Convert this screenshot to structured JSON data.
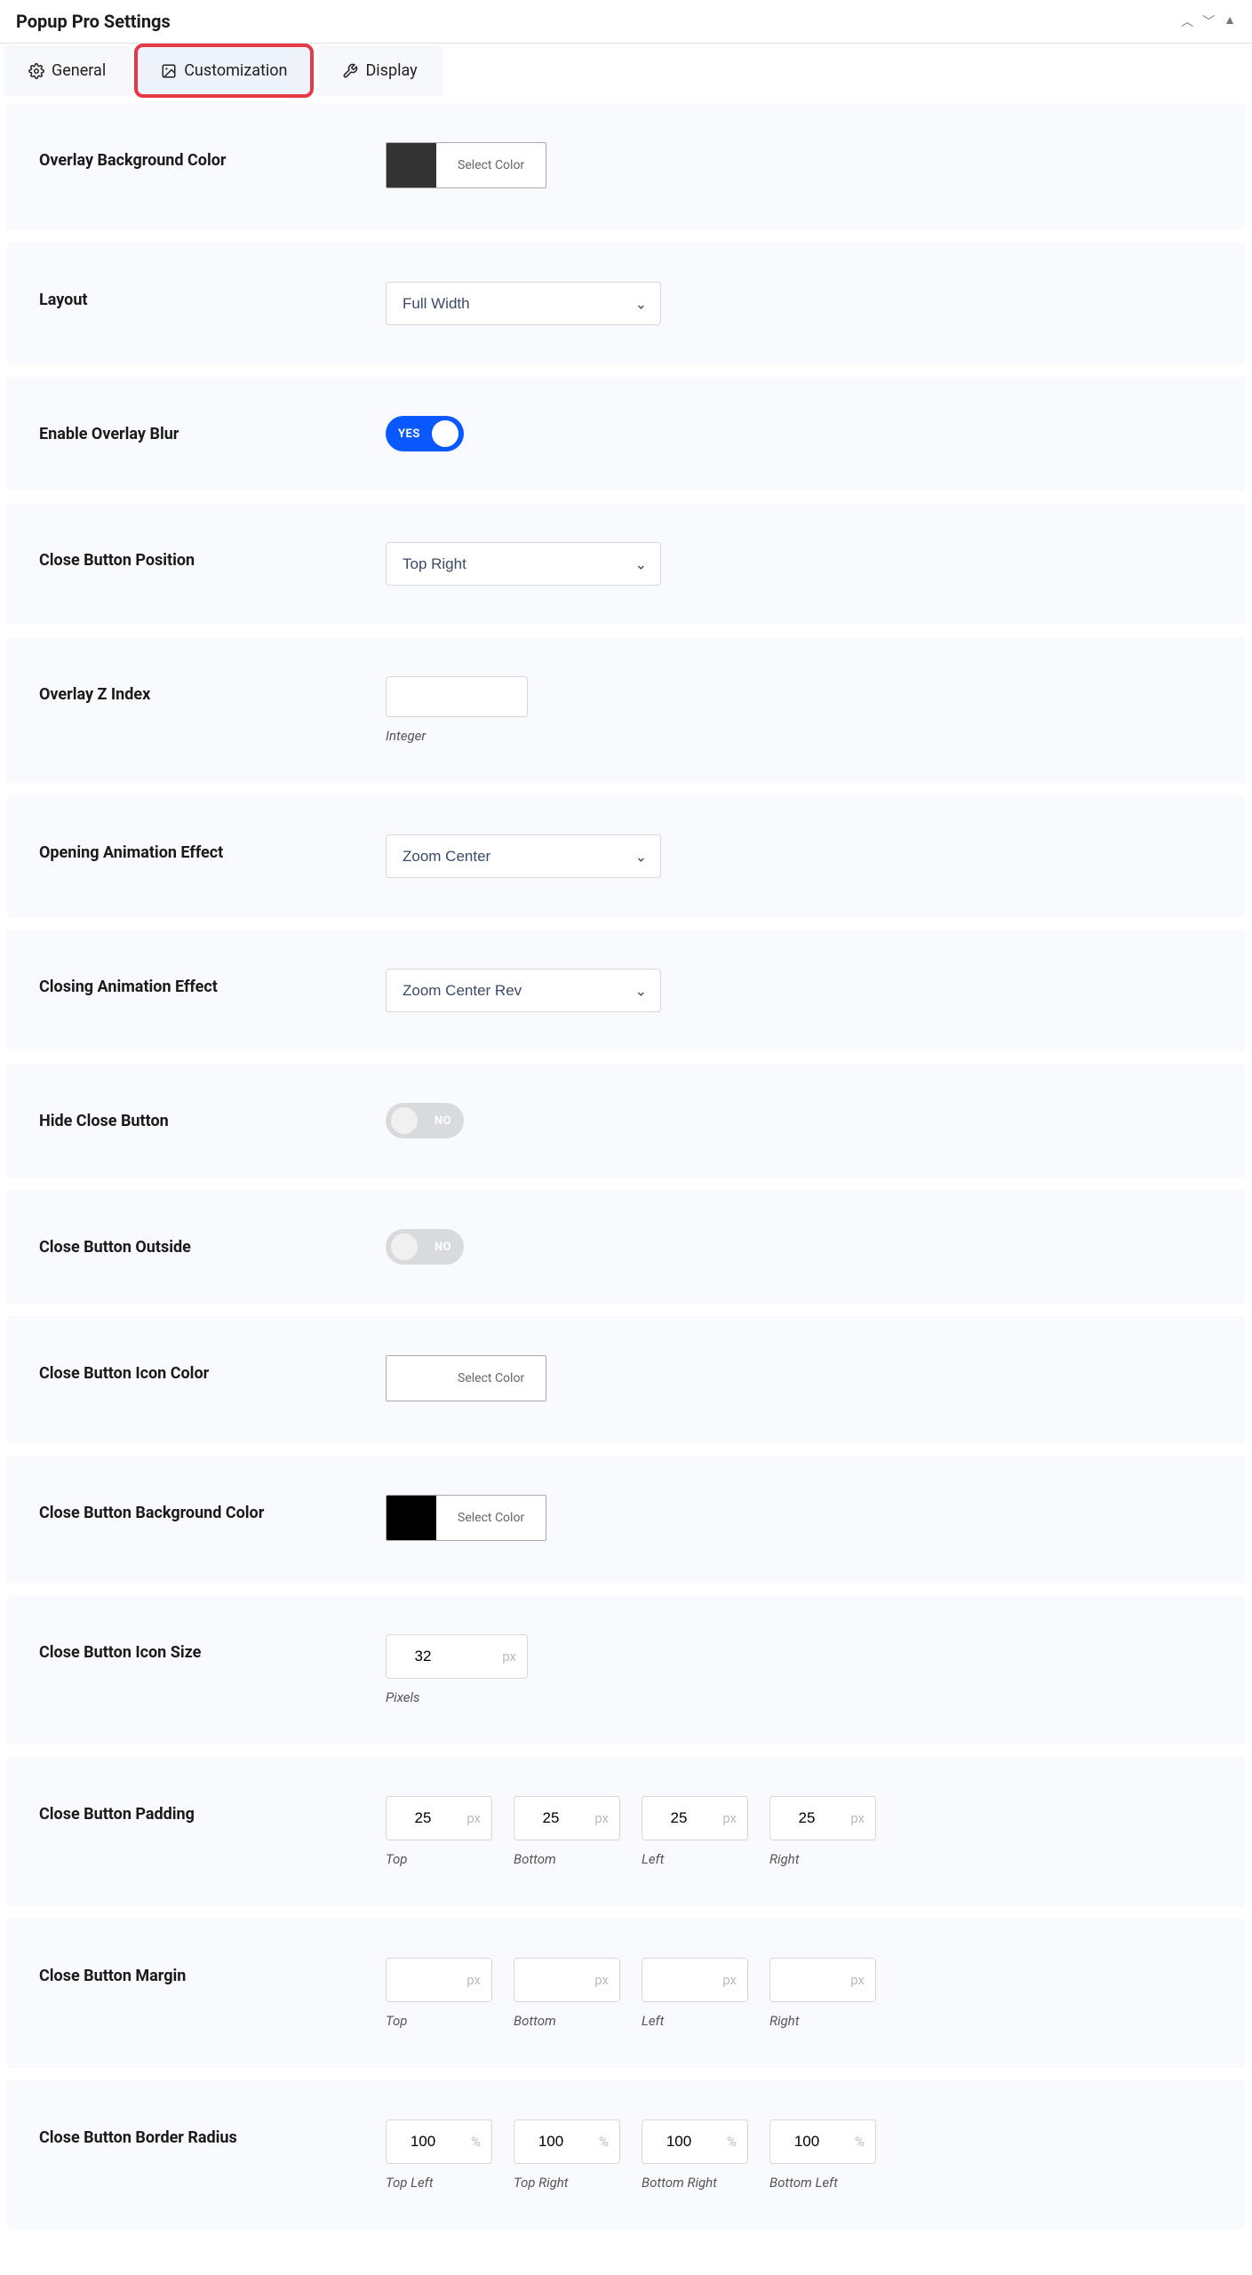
{
  "header": {
    "title": "Popup Pro Settings"
  },
  "tabs": {
    "general": "General",
    "customization": "Customization",
    "display": "Display"
  },
  "selectColorLabel": "Select Color",
  "fields": {
    "overlay_bg": {
      "label": "Overlay Background Color",
      "swatch": "#333333"
    },
    "layout": {
      "label": "Layout",
      "value": "Full Width"
    },
    "overlay_blur": {
      "label": "Enable Overlay Blur",
      "value": true,
      "on": "YES",
      "off": "NO"
    },
    "close_pos": {
      "label": "Close Button Position",
      "value": "Top Right"
    },
    "zindex": {
      "label": "Overlay Z Index",
      "value": "",
      "hint": "Integer"
    },
    "open_anim": {
      "label": "Opening Animation Effect",
      "value": "Zoom Center"
    },
    "close_anim": {
      "label": "Closing Animation Effect",
      "value": "Zoom Center Rev"
    },
    "hide_close": {
      "label": "Hide Close Button",
      "value": false,
      "on": "YES",
      "off": "NO"
    },
    "close_outside": {
      "label": "Close Button Outside",
      "value": false,
      "on": "YES",
      "off": "NO"
    },
    "close_icon_color": {
      "label": "Close Button Icon Color",
      "swatch": "#ffffff"
    },
    "close_bg_color": {
      "label": "Close Button Background Color",
      "swatch": "#000000"
    },
    "close_icon_size": {
      "label": "Close Button Icon Size",
      "value": "32",
      "unit": "px",
      "hint": "Pixels"
    },
    "close_padding": {
      "label": "Close Button Padding",
      "unit": "px",
      "top": "25",
      "bottom": "25",
      "left": "25",
      "right": "25",
      "labels": {
        "top": "Top",
        "bottom": "Bottom",
        "left": "Left",
        "right": "Right"
      }
    },
    "close_margin": {
      "label": "Close Button Margin",
      "unit": "px",
      "top": "",
      "bottom": "",
      "left": "",
      "right": "",
      "labels": {
        "top": "Top",
        "bottom": "Bottom",
        "left": "Left",
        "right": "Right"
      }
    },
    "close_radius": {
      "label": "Close Button Border Radius",
      "unit": "%",
      "tl": "100",
      "tr": "100",
      "br": "100",
      "bl": "100",
      "labels": {
        "tl": "Top Left",
        "tr": "Top Right",
        "br": "Bottom Right",
        "bl": "Bottom Left"
      }
    }
  }
}
